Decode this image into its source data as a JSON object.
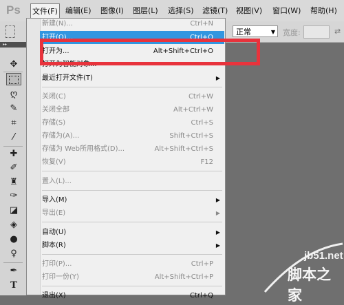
{
  "app_logo": "Ps",
  "menubar": {
    "items": [
      "文件(F)",
      "编辑(E)",
      "图像(I)",
      "图层(L)",
      "选择(S)",
      "滤镜(T)",
      "视图(V)",
      "窗口(W)",
      "帮助(H)"
    ],
    "active": "文件(F)"
  },
  "options": {
    "mode": "正常",
    "width_label": "宽度:"
  },
  "toolbox": {
    "tools": [
      "move-tool",
      "rectangular-marquee-tool",
      "lasso-tool",
      "quick-selection-tool",
      "crop-tool",
      "eyedropper-tool",
      "spot-healing-brush-tool",
      "brush-tool",
      "clone-stamp-tool",
      "history-brush-tool",
      "eraser-tool",
      "gradient-tool",
      "blur-tool",
      "dodge-tool",
      "pen-tool",
      "type-tool"
    ]
  },
  "file_menu": {
    "items": [
      {
        "label": "新建(N)...",
        "shortcut": "Ctrl+N",
        "state": "partial"
      },
      {
        "label": "打开(O)...",
        "shortcut": "Ctrl+O",
        "state": "highlighted"
      },
      {
        "label": "打开为...",
        "shortcut": "Alt+Shift+Ctrl+O",
        "state": "partial"
      },
      {
        "label": "打开为智能对象...",
        "shortcut": "",
        "state": "enabled"
      },
      {
        "label": "最近打开文件(T)",
        "shortcut": "",
        "state": "enabled",
        "submenu": true
      },
      {
        "label": "关闭(C)",
        "shortcut": "Ctrl+W",
        "state": "disabled"
      },
      {
        "label": "关闭全部",
        "shortcut": "Alt+Ctrl+W",
        "state": "disabled"
      },
      {
        "label": "存储(S)",
        "shortcut": "Ctrl+S",
        "state": "disabled"
      },
      {
        "label": "存储为(A)...",
        "shortcut": "Shift+Ctrl+S",
        "state": "disabled"
      },
      {
        "label": "存储为 Web所用格式(D)...",
        "shortcut": "Alt+Shift+Ctrl+S",
        "state": "disabled"
      },
      {
        "label": "恢复(V)",
        "shortcut": "F12",
        "state": "disabled"
      },
      {
        "label": "置入(L)...",
        "shortcut": "",
        "state": "disabled"
      },
      {
        "label": "导入(M)",
        "shortcut": "",
        "state": "enabled",
        "submenu": true
      },
      {
        "label": "导出(E)",
        "shortcut": "",
        "state": "disabled",
        "submenu": true
      },
      {
        "label": "自动(U)",
        "shortcut": "",
        "state": "enabled",
        "submenu": true
      },
      {
        "label": "脚本(R)",
        "shortcut": "",
        "state": "enabled",
        "submenu": true
      },
      {
        "label": "打印(P)...",
        "shortcut": "Ctrl+P",
        "state": "disabled"
      },
      {
        "label": "打印一份(Y)",
        "shortcut": "Alt+Shift+Ctrl+P",
        "state": "disabled"
      },
      {
        "label": "退出(X)",
        "shortcut": "Ctrl+Q",
        "state": "partial"
      }
    ]
  },
  "watermark": {
    "url": "jb51.net",
    "name": "脚本之家"
  },
  "colors": {
    "highlight": "#3296e0",
    "annotation_box": "#e8333c",
    "canvas": "#6f6f6f"
  }
}
